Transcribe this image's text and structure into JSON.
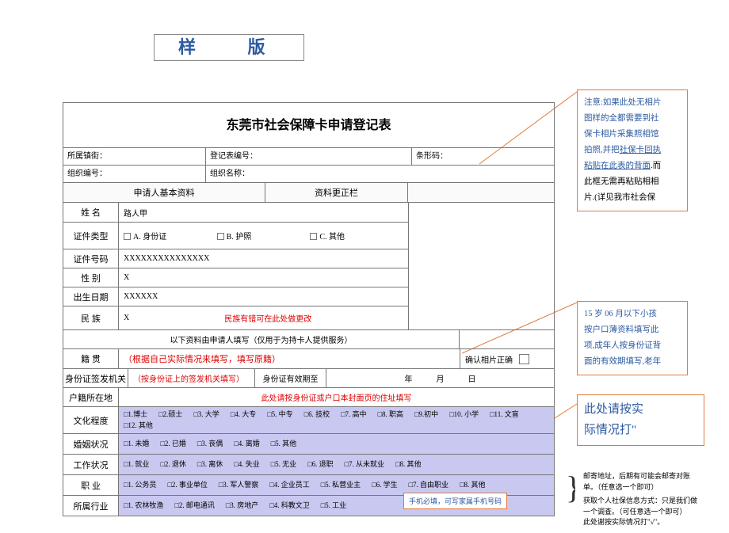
{
  "banner": "样  版",
  "title": "东莞市社会保障卡申请登记表",
  "header": {
    "town_label": "所属镇街：",
    "reg_label": "登记表编号：",
    "barcode_label": "条形码：",
    "org_code_label": "组织编号：",
    "org_name_label": "组织名称："
  },
  "sections": {
    "basic": "申请人基本资料",
    "correction": "资料更正栏"
  },
  "rows": {
    "name_label": "姓    名",
    "name_value": "路人甲",
    "doc_type_label": "证件类型",
    "doc_opt_a": "A. 身份证",
    "doc_opt_b": "B. 护照",
    "doc_opt_c": "C. 其他",
    "doc_no_label": "证件号码",
    "doc_no_value": "XXXXXXXXXXXXXXX",
    "gender_label": "性    别",
    "gender_value": "X",
    "dob_label": "出生日期",
    "dob_value": "XXXXXX",
    "ethnic_label": "民    族",
    "ethnic_value": "X",
    "ethnic_note": "民族有错可在此处做更改"
  },
  "service_header": "以下资料由申请人填写（仅用于为持卡人提供服务）",
  "native": {
    "label": "籍    贯",
    "hint": "（根据自己实际情况来填写，填写原籍）",
    "confirm_label": "确认相片正确"
  },
  "id_agency": {
    "label": "身份证签发机关",
    "hint": "（按身份证上的签发机关填写）",
    "expiry_label": "身份证有效期至",
    "y": "年",
    "m": "月",
    "d": "日"
  },
  "registered": {
    "label": "户籍所在地",
    "hint": "此处请按身份证或户口本封面页的住址填写"
  },
  "education": {
    "label": "文化程度",
    "options": [
      "□1.博士",
      "□2.硕士",
      "□3. 大学",
      "□4. 大专",
      "□5. 中专",
      "□6. 技校",
      "□7. 高中",
      "□8. 职高",
      "□9.初中",
      "□10. 小学",
      "□11. 文盲",
      "□12. 其他"
    ]
  },
  "marriage": {
    "label": "婚姻状况",
    "options": [
      "□1. 未婚",
      "□2. 已婚",
      "□3. 丧偶",
      "□4. 离婚",
      "□5. 其他"
    ]
  },
  "work": {
    "label": "工作状况",
    "options": [
      "□1. 就业",
      "□2. 退休",
      "□3. 离休",
      "□4. 失业",
      "□5. 无业",
      "□6. 退职",
      "□7. 从未就业",
      "□8. 其他"
    ]
  },
  "occupation": {
    "label": "职    业",
    "options": [
      "□1. 公务员",
      "□2. 事业单位",
      "□3. 军人警察",
      "□4. 企业员工",
      "□5. 私营业主",
      "□6. 学生",
      "□7. 自由职业",
      "□8. 其他"
    ]
  },
  "industry": {
    "label": "所属行业",
    "options": [
      "□1. 农林牧渔",
      "□2. 邮电通讯",
      "□3. 房地产",
      "□4. 科教文卫",
      "□5. 工业"
    ]
  },
  "annotations": {
    "a1_l1": "注意:如果此处无相片",
    "a1_l2": "图样的全都需要到社",
    "a1_l3": "保卡相片采集照相馆",
    "a1_l4": "拍照,并把",
    "a1_l4b": "社保卡回执",
    "a1_l5": "粘贴在此表的背面",
    "a1_l5b": ".而",
    "a1_l6": "此框无需再粘贴相相",
    "a1_l7": "片.(详见我市社会保",
    "a2_l1": "15 岁 06 月以下小孩",
    "a2_l2": "按户口薄资料填写此",
    "a2_l3": "项,成年人按身份证背",
    "a2_l4": "面的有效期填写,老年",
    "a3_l1": "此处请按实",
    "a3_l2": "际情况打\"",
    "a3_l3": "√\"",
    "a4_t1": "邮寄地址，后期有可能会邮寄对账单。（任意选一个即可）",
    "a4_t2": "获取个人社保信息方式：只是我们做一个调查。（可任意选一个即可）",
    "a4_t3": "此处谢按实际情况打\"√\"。"
  },
  "phone_note": "手机必填，可写家属手机号码"
}
